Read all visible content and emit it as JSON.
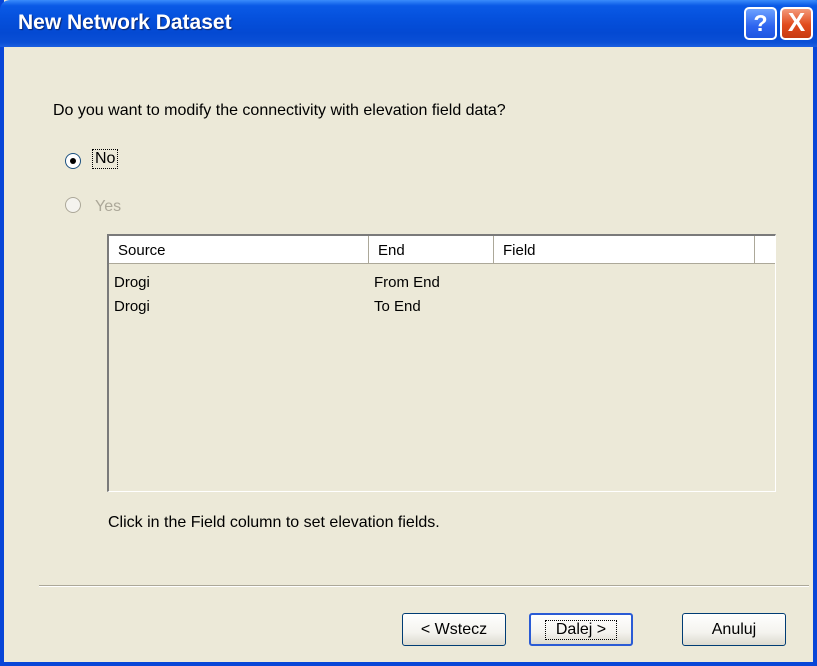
{
  "window": {
    "title": "New Network Dataset"
  },
  "titlebar": {
    "help_label": "?",
    "close_label": "X"
  },
  "question": "Do you want to modify the connectivity with elevation field data?",
  "options": {
    "no_label": "No",
    "yes_label": "Yes",
    "selected": "No"
  },
  "table": {
    "columns": [
      "Source",
      "End",
      "Field"
    ],
    "rows": [
      {
        "source": "Drogi",
        "end": "From End",
        "field": ""
      },
      {
        "source": "Drogi",
        "end": "To End",
        "field": ""
      }
    ]
  },
  "hint": "Click in the Field column to set elevation fields.",
  "buttons": {
    "back": "< Wstecz",
    "next": "Dalej >",
    "cancel": "Anuluj"
  }
}
